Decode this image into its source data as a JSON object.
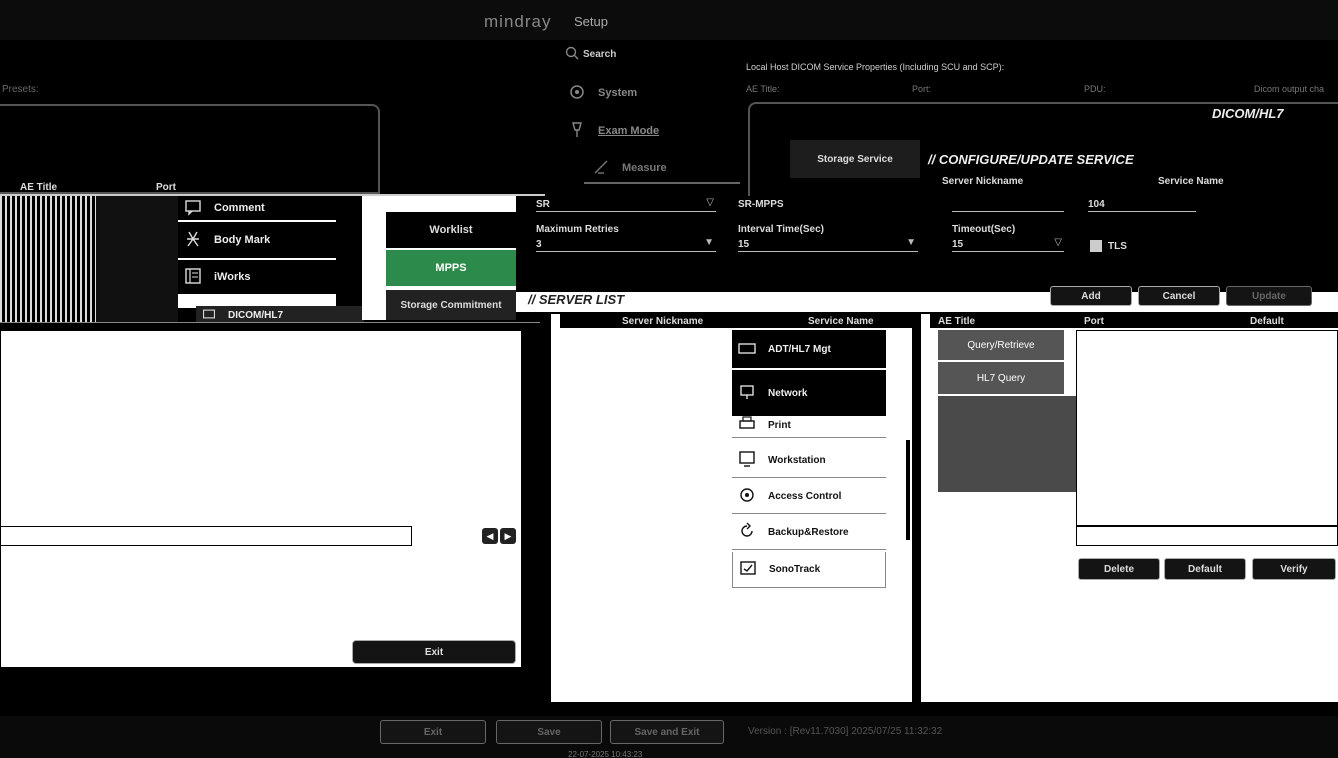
{
  "app": {
    "brand": "mindray",
    "title": "Setup",
    "left_header_label": "Presets:",
    "date_time": "22-07-2025  10:43:23"
  },
  "setup_menu": {
    "search_placeholder": "Search",
    "items": [
      {
        "label": "System",
        "icon": "gear-icon"
      },
      {
        "label": "Exam Mode",
        "icon": "probe-icon"
      },
      {
        "label": "Measure",
        "icon": "ruler-icon"
      },
      {
        "label": "Comment",
        "icon": "comment-icon"
      },
      {
        "label": "Body Mark",
        "icon": "body-icon"
      },
      {
        "label": "iWorks",
        "icon": "list-icon"
      },
      {
        "label": "DICOM/HL7",
        "icon": "network-icon"
      }
    ],
    "items_right": [
      {
        "label": "ADT/HL7 Mgt",
        "icon": "keyboard-icon"
      },
      {
        "label": "Network",
        "icon": "network-icon"
      },
      {
        "label": "Print",
        "icon": "printer-icon"
      },
      {
        "label": "Workstation",
        "icon": "monitor-icon"
      },
      {
        "label": "Access Control",
        "icon": "lock-icon"
      },
      {
        "label": "Backup&Restore",
        "icon": "refresh-icon"
      },
      {
        "label": "SonoTrack",
        "icon": "track-icon"
      }
    ]
  },
  "dicom": {
    "local_host_label": "Local Host DICOM Service Properties (Including SCU and SCP):",
    "ae_title_label": "AE Title:",
    "port_label": "Port:",
    "pdu_label": "PDU:",
    "dicom_output_label": "Dicom output cha",
    "section_title": "DICOM/HL7",
    "configure_title": "// CONFIGURE/UPDATE SERVICE",
    "server_nickname_label": "Server Nickname",
    "service_name_label": "Service Name",
    "service_name_value": "SR-MPPS",
    "ae_title_value": "SR",
    "max_retries_label": "Maximum Retries",
    "max_retries_value": "3",
    "interval_label": "Interval Time(Sec)",
    "interval_value": "15",
    "timeout_label": "Timeout(Sec)",
    "timeout_value": "15",
    "port_value": "104",
    "tls_label": "TLS",
    "server_list_title": "// SERVER LIST",
    "add_label": "Add",
    "cancel_label": "Cancel",
    "update_label": "Update",
    "left_table_headers": [
      "AE Title",
      "Port"
    ],
    "service_tabs": [
      "Storage Service",
      "Worklist",
      "MPPS",
      "Storage Commitment",
      "Query/Retrieve",
      "HL7 Query"
    ],
    "list_headers": [
      "Server Nickname",
      "Service Name",
      "AE Title",
      "Port",
      "Default"
    ],
    "delete_label": "Delete",
    "default_label": "Default",
    "verify_label": "Verify",
    "exit_label": "Exit"
  },
  "footer": {
    "exit_label": "Exit",
    "save_label": "Save",
    "save_exit_label": "Save and Exit",
    "version_text": "Version : [Rev11.7030] 2025/07/25 11:32:32"
  }
}
